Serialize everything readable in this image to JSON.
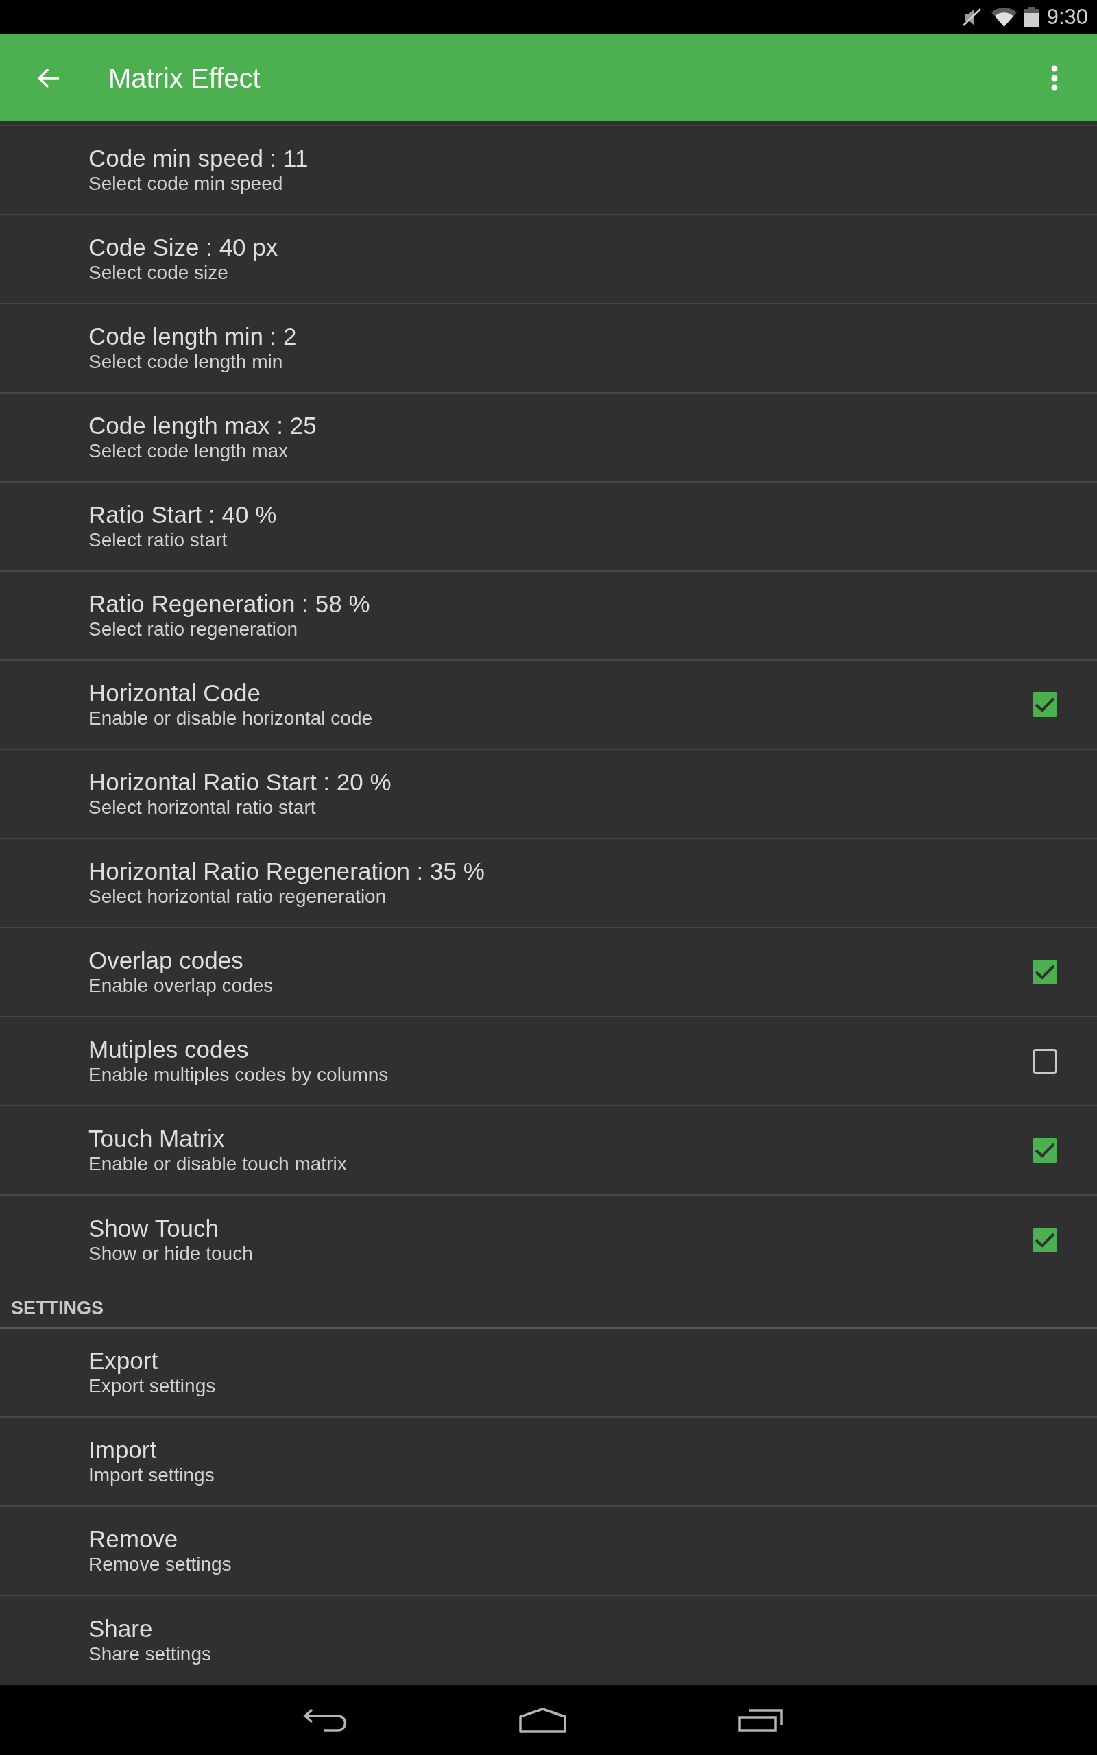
{
  "status_bar": {
    "time": "9:30"
  },
  "app_bar": {
    "title": "Matrix Effect"
  },
  "preferences": [
    {
      "kind": "plain",
      "title": "Code min speed : 11",
      "summary": "Select code min speed"
    },
    {
      "kind": "plain",
      "title": "Code Size : 40 px",
      "summary": "Select code size"
    },
    {
      "kind": "plain",
      "title": "Code length min : 2",
      "summary": "Select code length min"
    },
    {
      "kind": "plain",
      "title": "Code length max : 25",
      "summary": "Select code length max"
    },
    {
      "kind": "plain",
      "title": "Ratio Start : 40 %",
      "summary": "Select ratio start"
    },
    {
      "kind": "plain",
      "title": "Ratio Regeneration : 58 %",
      "summary": "Select ratio regeneration"
    },
    {
      "kind": "checkbox",
      "title": "Horizontal Code",
      "summary": "Enable or disable horizontal code",
      "checked": true
    },
    {
      "kind": "plain",
      "title": "Horizontal Ratio Start : 20 %",
      "summary": "Select horizontal ratio start"
    },
    {
      "kind": "plain",
      "title": "Horizontal Ratio Regeneration : 35 %",
      "summary": "Select horizontal ratio regeneration"
    },
    {
      "kind": "checkbox",
      "title": "Overlap codes",
      "summary": "Enable overlap codes",
      "checked": true
    },
    {
      "kind": "checkbox",
      "title": "Mutiples codes",
      "summary": "Enable multiples codes by columns",
      "checked": false
    },
    {
      "kind": "checkbox",
      "title": "Touch Matrix",
      "summary": "Enable or disable touch matrix",
      "checked": true
    },
    {
      "kind": "checkbox",
      "title": "Show Touch",
      "summary": "Show or hide touch",
      "checked": true
    }
  ],
  "settings_section": {
    "header": "SETTINGS",
    "items": [
      {
        "kind": "plain",
        "title": "Export",
        "summary": "Export settings"
      },
      {
        "kind": "plain",
        "title": "Import",
        "summary": "Import settings"
      },
      {
        "kind": "plain",
        "title": "Remove",
        "summary": "Remove settings"
      },
      {
        "kind": "plain",
        "title": "Share",
        "summary": "Share settings"
      }
    ]
  }
}
